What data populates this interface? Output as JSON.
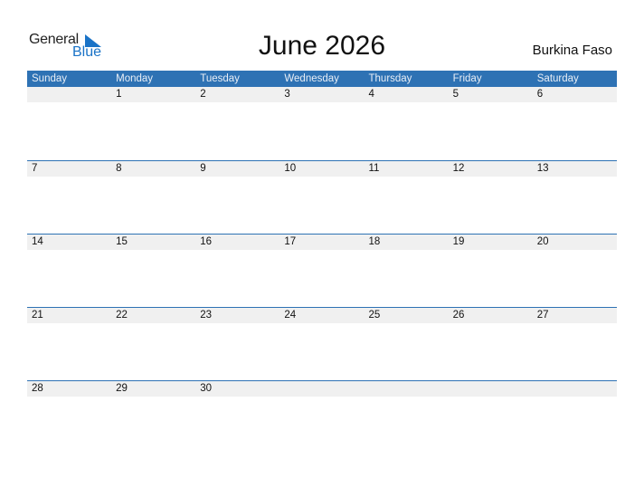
{
  "logo": {
    "text_primary": "General",
    "text_secondary": "Blue",
    "icon": "triangle-flag-icon",
    "brand_color": "#1a73c7"
  },
  "title": "June 2026",
  "country": "Burkina Faso",
  "colors": {
    "header_bg": "#2e72b4",
    "row_bg": "#f0f0f0"
  },
  "weekdays": [
    "Sunday",
    "Monday",
    "Tuesday",
    "Wednesday",
    "Thursday",
    "Friday",
    "Saturday"
  ],
  "weeks": [
    [
      "",
      "1",
      "2",
      "3",
      "4",
      "5",
      "6"
    ],
    [
      "7",
      "8",
      "9",
      "10",
      "11",
      "12",
      "13"
    ],
    [
      "14",
      "15",
      "16",
      "17",
      "18",
      "19",
      "20"
    ],
    [
      "21",
      "22",
      "23",
      "24",
      "25",
      "26",
      "27"
    ],
    [
      "28",
      "29",
      "30",
      "",
      "",
      "",
      ""
    ]
  ]
}
